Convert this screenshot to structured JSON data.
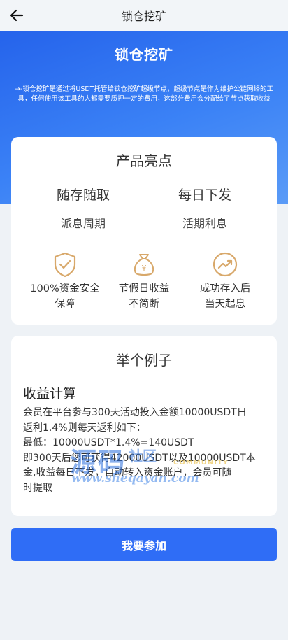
{
  "nav": {
    "title": "锁仓挖矿"
  },
  "hero": {
    "title": "锁仓挖矿",
    "description": "→-锁仓挖矿是通过将USDT托管给锁仓挖矿超级节点，超级节点是作为维护公链网络的工具，任何使用该工具的人都需要质押一定的费用，这部分费用会分配给了节点获取收益"
  },
  "highlights": {
    "title": "产品亮点",
    "features": [
      {
        "title": "随存随取",
        "sub": "派息周期"
      },
      {
        "title": "每日下发",
        "sub": "活期利息"
      }
    ],
    "items": [
      {
        "icon": "shield-check-icon",
        "line1": "100%资金安全",
        "line2": "保障"
      },
      {
        "icon": "money-bag-icon",
        "line1": "节假日收益",
        "line2": "不简断"
      },
      {
        "icon": "trend-up-icon",
        "line1": "成功存入后",
        "line2": "当天起息"
      }
    ]
  },
  "example": {
    "title": "举个例子",
    "heading": "收益计算",
    "lines": [
      "会员在平台参与300天活动投入金额10000USDT日",
      "返利1.4%则每天返利如下：",
      "最低：10000USDT*1.4%=140USDT",
      "即300天后您可获得42000USDT以及10000USDT本",
      "金,收益每日下发，自动转入资金账户，会员可随",
      "时提取"
    ]
  },
  "watermark": {
    "big": "源码",
    "small": "社区",
    "community": "COMMUNITY",
    "url": "www.sheqayan.com"
  },
  "cta": {
    "label": "我要参加"
  },
  "colors": {
    "primary": "#2f6df6",
    "icon_gold": "#d8a86a"
  }
}
